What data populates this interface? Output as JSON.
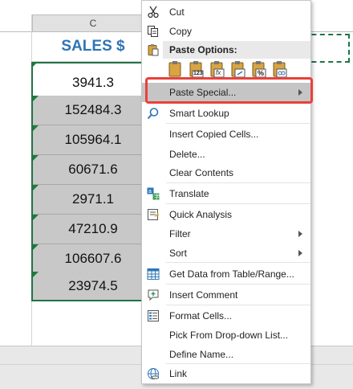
{
  "sheet": {
    "column_letter": "C",
    "header_title": "SALES $",
    "values": [
      "3941.3",
      "152484.3",
      "105964.1",
      "60671.6",
      "2971.1",
      "47210.9",
      "106607.6",
      "23974.5"
    ]
  },
  "menu": {
    "items": {
      "cut": "Cut",
      "copy": "Copy",
      "paste_options": "Paste Options:",
      "paste_special": "Paste Special...",
      "smart_lookup": "Smart Lookup",
      "insert_copied": "Insert Copied Cells...",
      "delete": "Delete...",
      "clear_contents": "Clear Contents",
      "translate": "Translate",
      "quick_analysis": "Quick Analysis",
      "filter": "Filter",
      "sort": "Sort",
      "get_data": "Get Data from Table/Range...",
      "insert_comment": "Insert Comment",
      "format_cells": "Format Cells...",
      "pick_dropdown": "Pick From Drop-down List...",
      "define_name": "Define Name...",
      "link": "Link"
    },
    "paste_icon_labels": {
      "values_123": "123",
      "formulas_fx": "fx",
      "percent": "%"
    }
  },
  "colors": {
    "title_blue": "#2e75b6",
    "selection_green": "#217346",
    "highlight_red": "#e8423b"
  }
}
